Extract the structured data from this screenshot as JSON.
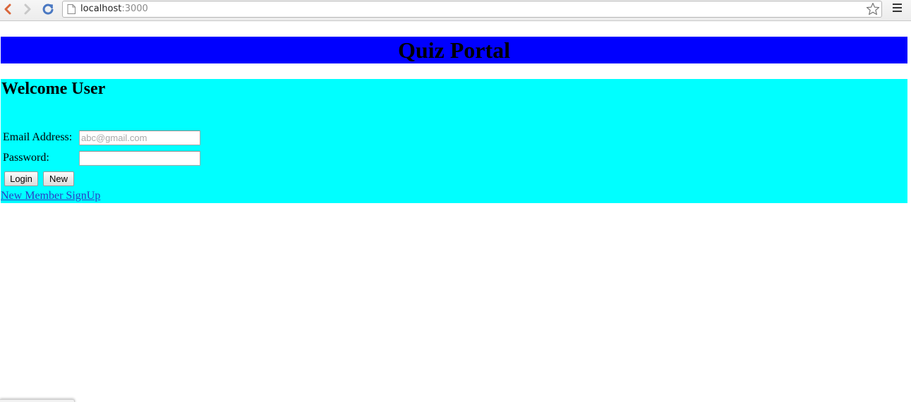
{
  "browser": {
    "url_host": "localhost",
    "url_port": ":3000",
    "icons": {
      "back": "back-arrow-icon",
      "forward": "forward-arrow-icon",
      "reload": "reload-icon",
      "page": "page-icon",
      "bookmark": "star-icon",
      "menu": "hamburger-menu-icon"
    }
  },
  "header": {
    "title": "Quiz Portal",
    "background": "#0000ff"
  },
  "login": {
    "background": "#00ffff",
    "welcome": "Welcome User",
    "email_label": "Email Address:",
    "email_value": "",
    "email_placeholder": "abc@gmail.com",
    "password_label": "Password:",
    "password_value": "",
    "login_button": "Login",
    "new_button": "New",
    "signup_link": "New Member SignUp"
  }
}
